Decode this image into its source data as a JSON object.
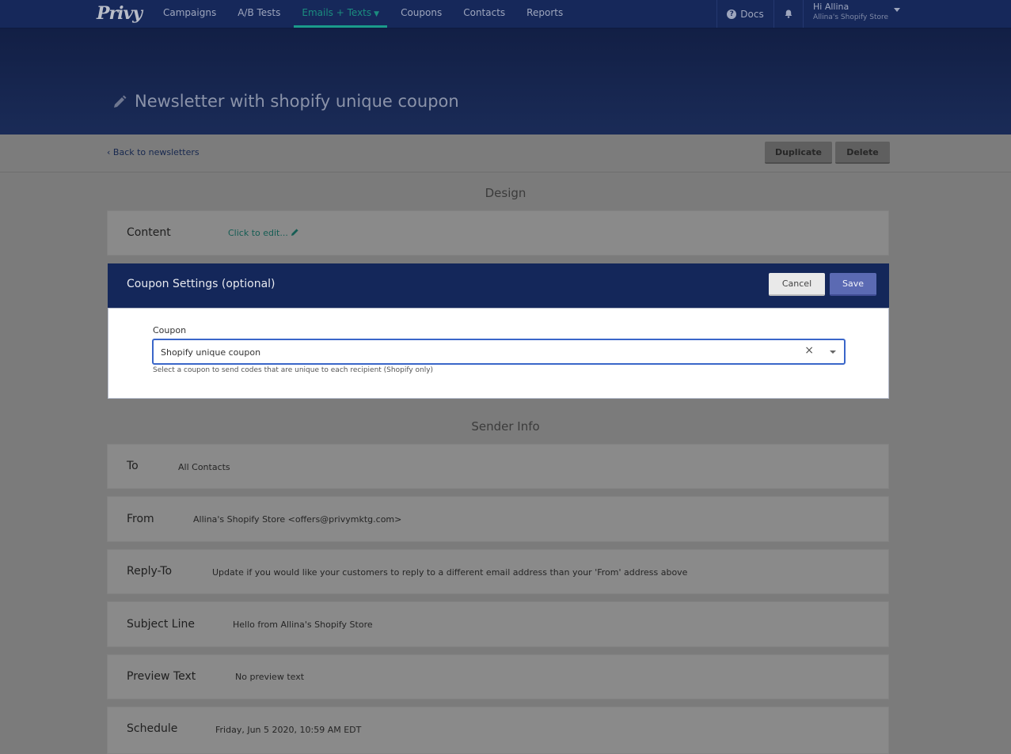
{
  "nav": {
    "logo": "Privy",
    "items": [
      {
        "label": "Campaigns"
      },
      {
        "label": "A/B Tests"
      },
      {
        "label": "Emails + Texts",
        "active": true
      },
      {
        "label": "Coupons"
      },
      {
        "label": "Contacts"
      },
      {
        "label": "Reports"
      }
    ],
    "docs": "Docs",
    "user_greeting": "Hi Allina",
    "user_store": "Allina's Shopify Store"
  },
  "header": {
    "title": "Newsletter with shopify unique coupon"
  },
  "subbar": {
    "back": "Back to newsletters",
    "duplicate": "Duplicate",
    "delete": "Delete"
  },
  "design": {
    "section_title": "Design",
    "content_label": "Content",
    "content_value": "Click to edit..."
  },
  "coupon": {
    "title": "Coupon Settings (optional)",
    "cancel": "Cancel",
    "save": "Save",
    "field_label": "Coupon",
    "selected": "Shopify unique coupon",
    "help": "Select a coupon to send codes that are unique to each recipient (Shopify only)"
  },
  "sender": {
    "section_title": "Sender Info",
    "rows": [
      {
        "label": "To",
        "value": "All Contacts"
      },
      {
        "label": "From",
        "value": "Allina's Shopify Store <offers@privymktg.com>"
      },
      {
        "label": "Reply-To",
        "value": "Update if you would like your customers to reply to a different email address than your 'From' address above"
      },
      {
        "label": "Subject Line",
        "value": "Hello from Allina's Shopify Store"
      },
      {
        "label": "Preview Text",
        "value": "No preview text"
      },
      {
        "label": "Schedule",
        "value": "Friday, Jun 5 2020, 10:59 AM EDT"
      }
    ]
  },
  "colors": {
    "nav_bg": "#16285a",
    "accent": "#1a9b8b",
    "save": "#5b6ab3"
  }
}
